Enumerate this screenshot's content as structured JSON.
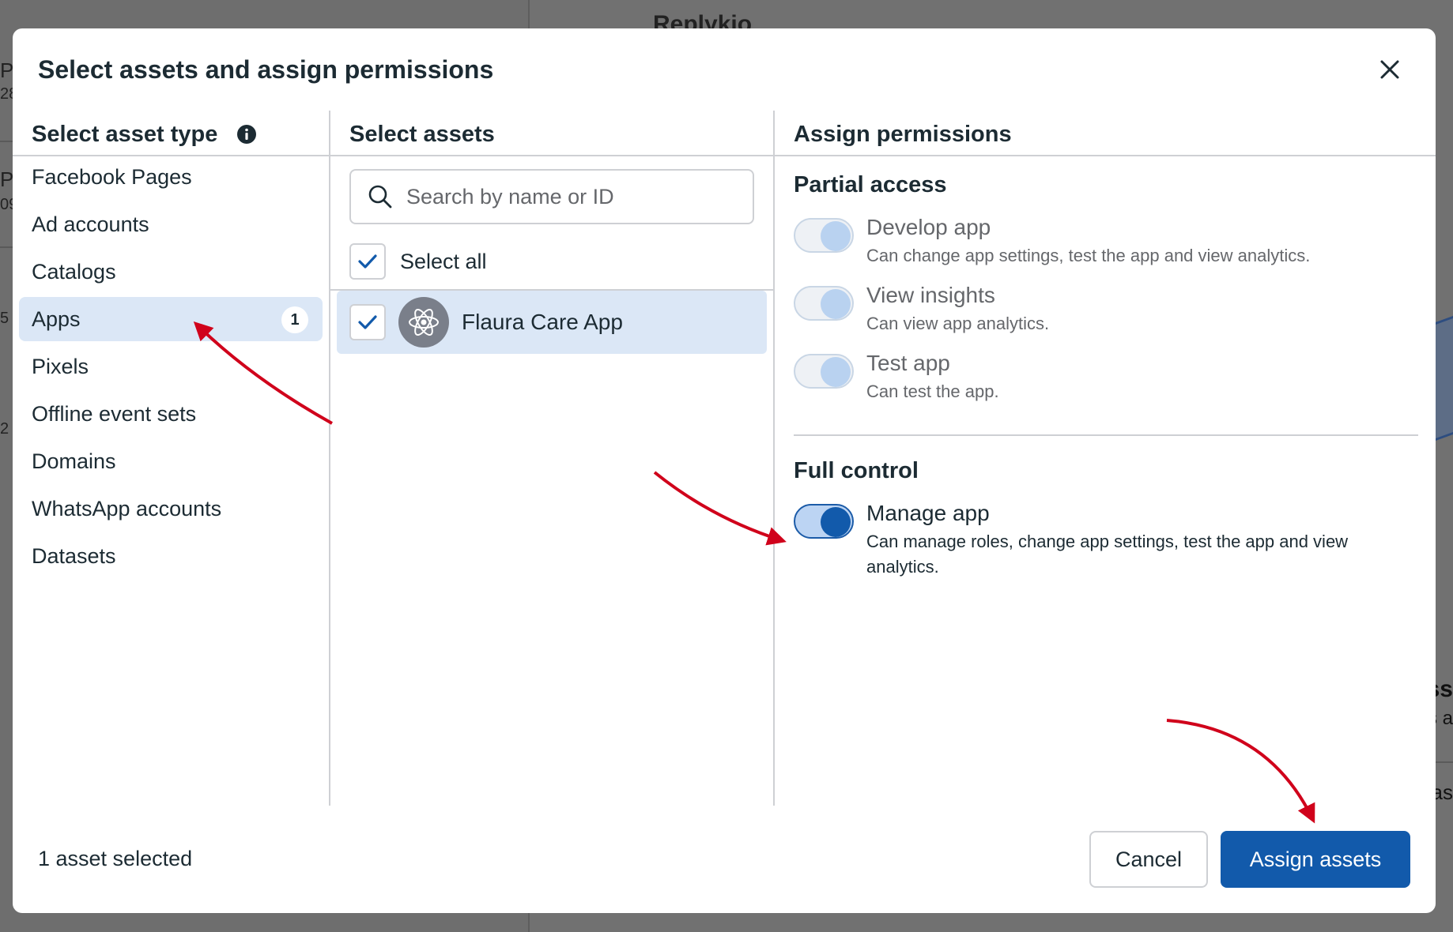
{
  "background": {
    "title_fragment": "Replykio",
    "left_fragments": [
      "P",
      "28",
      "P",
      "09",
      "5",
      "2"
    ],
    "right_fragments": [
      "ss",
      "s a",
      "as"
    ]
  },
  "modal": {
    "title": "Select assets and assign permissions",
    "close_icon": "close-icon"
  },
  "asset_types": {
    "header": "Select asset type",
    "info_icon": "info-icon",
    "items": [
      {
        "label": "Facebook Pages",
        "selected": false
      },
      {
        "label": "Ad accounts",
        "selected": false
      },
      {
        "label": "Catalogs",
        "selected": false
      },
      {
        "label": "Apps",
        "selected": true,
        "count": "1"
      },
      {
        "label": "Pixels",
        "selected": false
      },
      {
        "label": "Offline event sets",
        "selected": false
      },
      {
        "label": "Domains",
        "selected": false
      },
      {
        "label": "WhatsApp accounts",
        "selected": false
      },
      {
        "label": "Datasets",
        "selected": false
      }
    ]
  },
  "assets": {
    "header": "Select assets",
    "search_placeholder": "Search by name or ID",
    "search_value": "",
    "select_all_label": "Select all",
    "select_all_checked": true,
    "items": [
      {
        "name": "Flaura Care App",
        "checked": true,
        "icon": "atom-icon"
      }
    ]
  },
  "permissions": {
    "header": "Assign permissions",
    "partial_title": "Partial access",
    "partial": [
      {
        "name": "Develop app",
        "desc": "Can change app settings, test the app and view analytics.",
        "on": true
      },
      {
        "name": "View insights",
        "desc": "Can view app analytics.",
        "on": true
      },
      {
        "name": "Test app",
        "desc": "Can test the app.",
        "on": true
      }
    ],
    "full_title": "Full control",
    "full": [
      {
        "name": "Manage app",
        "desc": "Can manage roles, change app settings, test the app and view analytics.",
        "on": true
      }
    ]
  },
  "footer": {
    "status": "1 asset selected",
    "cancel_label": "Cancel",
    "assign_label": "Assign assets"
  },
  "colors": {
    "primary": "#125aab",
    "selected_bg": "#dbe7f6",
    "annotation_arrow": "#d0021b"
  }
}
